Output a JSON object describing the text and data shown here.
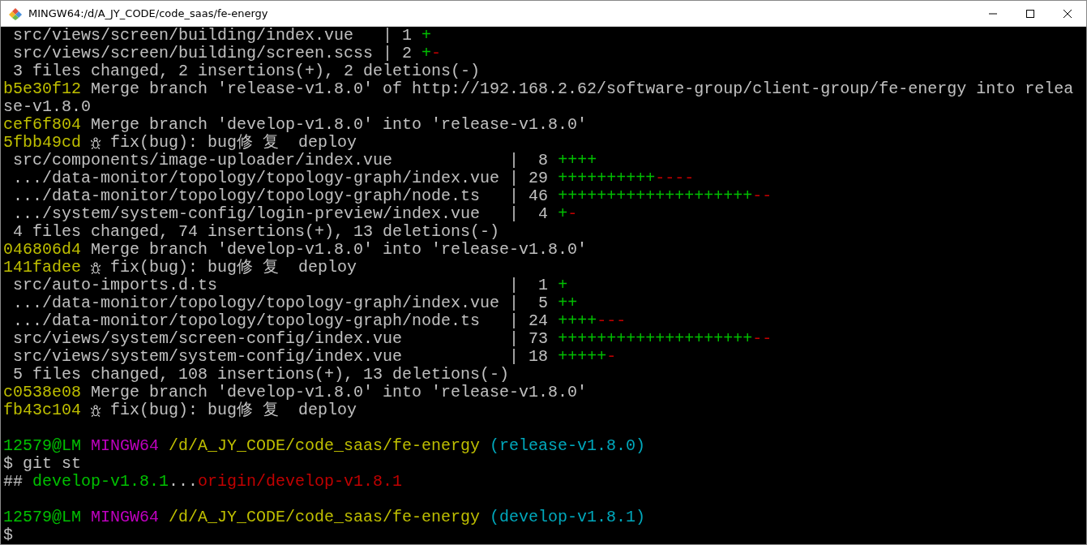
{
  "window": {
    "title": "MINGW64:/d/A_JY_CODE/code_saas/fe-energy"
  },
  "terminal": {
    "lines": [
      {
        "kind": "text",
        "segments": [
          {
            "kind": "plain",
            "text": " src/views/screen/building/index.vue   | 1 "
          },
          {
            "kind": "add",
            "text": "+"
          }
        ]
      },
      {
        "kind": "text",
        "segments": [
          {
            "kind": "plain",
            "text": " src/views/screen/building/screen.scss | 2 "
          },
          {
            "kind": "add",
            "text": "+"
          },
          {
            "kind": "del",
            "text": "-"
          }
        ]
      },
      {
        "kind": "text",
        "segments": [
          {
            "kind": "plain",
            "text": " 3 files changed, 2 insertions(+), 2 deletions(-)"
          }
        ]
      },
      {
        "kind": "text",
        "segments": [
          {
            "kind": "hash",
            "text": "b5e30f12"
          },
          {
            "kind": "plain",
            "text": " Merge branch 'release-v1.8.0' of http://192.168.2.62/software-group/client-group/fe-energy into relea"
          }
        ]
      },
      {
        "kind": "text",
        "segments": [
          {
            "kind": "plain",
            "text": "se-v1.8.0"
          }
        ]
      },
      {
        "kind": "text",
        "segments": [
          {
            "kind": "hash",
            "text": "cef6f804"
          },
          {
            "kind": "plain",
            "text": " Merge branch 'develop-v1.8.0' into 'release-v1.8.0'"
          }
        ]
      },
      {
        "kind": "text",
        "segments": [
          {
            "kind": "hash",
            "text": "5fbb49cd"
          },
          {
            "kind": "icon"
          },
          {
            "kind": "plain",
            "text": " fix(bug): bug修 复  deploy"
          }
        ]
      },
      {
        "kind": "text",
        "segments": [
          {
            "kind": "plain",
            "text": " src/components/image-uploader/index.vue            |  8 "
          },
          {
            "kind": "add",
            "text": "++++"
          }
        ]
      },
      {
        "kind": "text",
        "segments": [
          {
            "kind": "plain",
            "text": " .../data-monitor/topology/topology-graph/index.vue | 29 "
          },
          {
            "kind": "add",
            "text": "++++++++++"
          },
          {
            "kind": "del",
            "text": "----"
          }
        ]
      },
      {
        "kind": "text",
        "segments": [
          {
            "kind": "plain",
            "text": " .../data-monitor/topology/topology-graph/node.ts   | 46 "
          },
          {
            "kind": "add",
            "text": "++++++++++++++++++++"
          },
          {
            "kind": "del",
            "text": "--"
          }
        ]
      },
      {
        "kind": "text",
        "segments": [
          {
            "kind": "plain",
            "text": " .../system/system-config/login-preview/index.vue   |  4 "
          },
          {
            "kind": "add",
            "text": "+"
          },
          {
            "kind": "del",
            "text": "-"
          }
        ]
      },
      {
        "kind": "text",
        "segments": [
          {
            "kind": "plain",
            "text": " 4 files changed, 74 insertions(+), 13 deletions(-)"
          }
        ]
      },
      {
        "kind": "text",
        "segments": [
          {
            "kind": "hash",
            "text": "046806d4"
          },
          {
            "kind": "plain",
            "text": " Merge branch 'develop-v1.8.0' into 'release-v1.8.0'"
          }
        ]
      },
      {
        "kind": "text",
        "segments": [
          {
            "kind": "hash",
            "text": "141fadee"
          },
          {
            "kind": "icon"
          },
          {
            "kind": "plain",
            "text": " fix(bug): bug修 复  deploy"
          }
        ]
      },
      {
        "kind": "text",
        "segments": [
          {
            "kind": "plain",
            "text": " src/auto-imports.d.ts                              |  1 "
          },
          {
            "kind": "add",
            "text": "+"
          }
        ]
      },
      {
        "kind": "text",
        "segments": [
          {
            "kind": "plain",
            "text": " .../data-monitor/topology/topology-graph/index.vue |  5 "
          },
          {
            "kind": "add",
            "text": "++"
          }
        ]
      },
      {
        "kind": "text",
        "segments": [
          {
            "kind": "plain",
            "text": " .../data-monitor/topology/topology-graph/node.ts   | 24 "
          },
          {
            "kind": "add",
            "text": "++++"
          },
          {
            "kind": "del",
            "text": "---"
          }
        ]
      },
      {
        "kind": "text",
        "segments": [
          {
            "kind": "plain",
            "text": " src/views/system/screen-config/index.vue           | 73 "
          },
          {
            "kind": "add",
            "text": "++++++++++++++++++++"
          },
          {
            "kind": "del",
            "text": "--"
          }
        ]
      },
      {
        "kind": "text",
        "segments": [
          {
            "kind": "plain",
            "text": " src/views/system/system-config/index.vue           | 18 "
          },
          {
            "kind": "add",
            "text": "+++++"
          },
          {
            "kind": "del",
            "text": "-"
          }
        ]
      },
      {
        "kind": "text",
        "segments": [
          {
            "kind": "plain",
            "text": " 5 files changed, 108 insertions(+), 13 deletions(-)"
          }
        ]
      },
      {
        "kind": "text",
        "segments": [
          {
            "kind": "hash",
            "text": "c0538e08"
          },
          {
            "kind": "plain",
            "text": " Merge branch 'develop-v1.8.0' into 'release-v1.8.0'"
          }
        ]
      },
      {
        "kind": "text",
        "segments": [
          {
            "kind": "hash",
            "text": "fb43c104"
          },
          {
            "kind": "icon"
          },
          {
            "kind": "plain",
            "text": " fix(bug): bug修 复  deploy"
          }
        ]
      },
      {
        "kind": "blank"
      },
      {
        "kind": "text",
        "segments": [
          {
            "kind": "user",
            "text": "12579@LM"
          },
          {
            "kind": "host",
            "text": "MINGW64"
          },
          {
            "kind": "path",
            "text": "/d/A_JY_CODE/code_saas/fe-energy"
          },
          {
            "kind": "branch",
            "text": "(release-v1.8.0)"
          }
        ]
      },
      {
        "kind": "text",
        "segments": [
          {
            "kind": "plain",
            "text": "$ git st"
          }
        ]
      },
      {
        "kind": "text",
        "segments": [
          {
            "kind": "plain",
            "text": "## "
          },
          {
            "kind": "add",
            "text": "develop-v1.8.1"
          },
          {
            "kind": "plain",
            "text": "..."
          },
          {
            "kind": "del",
            "text": "origin/develop-v1.8.1"
          }
        ]
      },
      {
        "kind": "blank"
      },
      {
        "kind": "text",
        "segments": [
          {
            "kind": "user",
            "text": "12579@LM"
          },
          {
            "kind": "host",
            "text": "MINGW64"
          },
          {
            "kind": "path",
            "text": "/d/A_JY_CODE/code_saas/fe-energy"
          },
          {
            "kind": "branch",
            "text": "(develop-v1.8.1)"
          }
        ]
      },
      {
        "kind": "text",
        "segments": [
          {
            "kind": "plain",
            "text": "$"
          }
        ]
      }
    ]
  }
}
